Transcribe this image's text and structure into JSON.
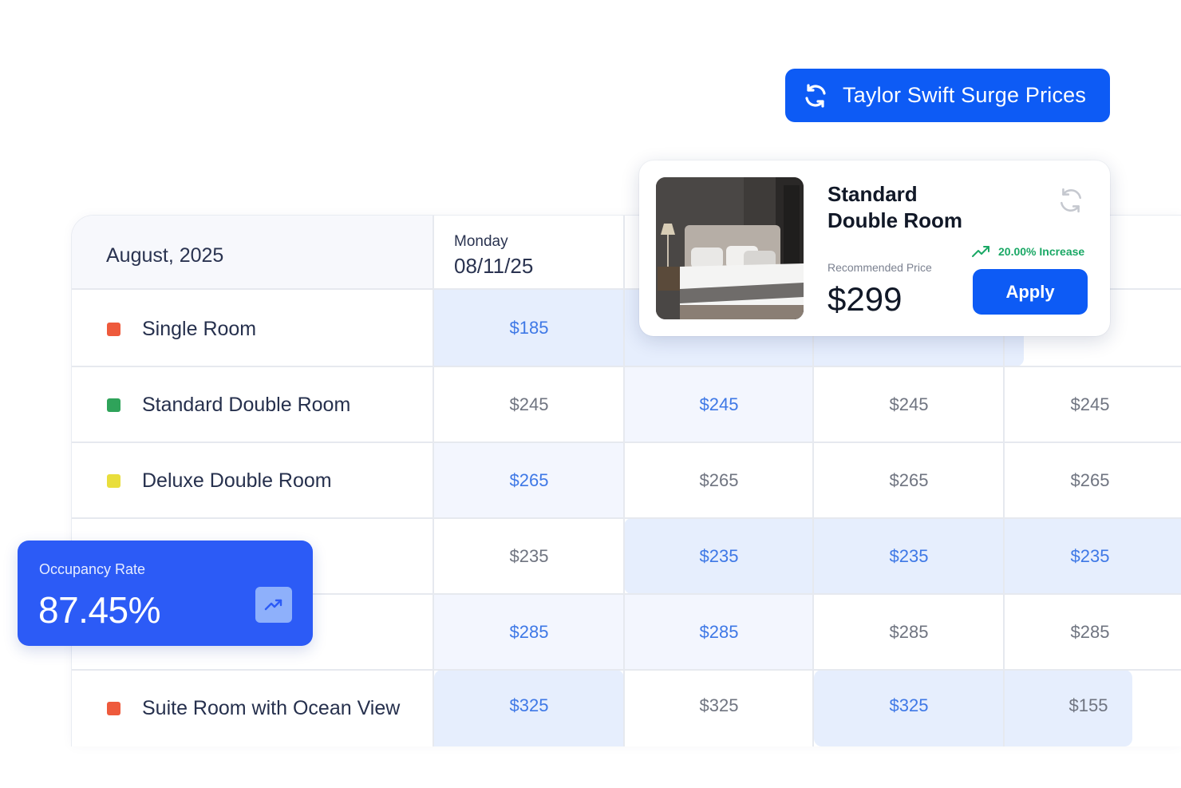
{
  "surge_button": {
    "label": "Taylor Swift Surge Prices",
    "icon": "refresh-icon"
  },
  "table": {
    "month": "August, 2025",
    "day": {
      "name": "Monday",
      "date": "08/11/25"
    },
    "rooms": [
      {
        "name": "Single Room",
        "color": "#ee5a3c",
        "prices": [
          "$185",
          "",
          "",
          ""
        ]
      },
      {
        "name": "Standard Double Room",
        "color": "#2fa35a",
        "prices": [
          "$245",
          "$245",
          "$245",
          "$245"
        ]
      },
      {
        "name": "Deluxe Double Room",
        "color": "#e9de3c",
        "prices": [
          "$265",
          "$265",
          "$265",
          "$265"
        ]
      },
      {
        "name": "",
        "color": "",
        "prices": [
          "$235",
          "$235",
          "$235",
          "$235"
        ]
      },
      {
        "name": "",
        "color": "",
        "prices": [
          "$285",
          "$285",
          "$285",
          "$285"
        ]
      },
      {
        "name": "Suite Room with Ocean View",
        "color": "#ee5a3c",
        "prices": [
          "$325",
          "$325",
          "$325",
          "$155"
        ]
      }
    ]
  },
  "occupancy": {
    "title": "Occupancy Rate",
    "value": "87.45%",
    "icon": "trend-up-icon"
  },
  "recommendation": {
    "room_line1": "Standard",
    "room_line2": "Double Room",
    "label": "Recommended Price",
    "price": "$299",
    "change": "20.00% Increase",
    "apply_label": "Apply",
    "colors": {
      "accent": "#0d5bf5",
      "increase": "#1aa865"
    }
  }
}
